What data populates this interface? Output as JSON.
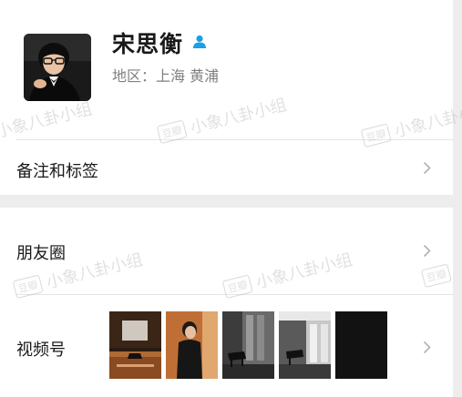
{
  "profile": {
    "name": "宋思衡",
    "region": "地区：上海 黄浦",
    "avatar_icon": "portrait-avatar",
    "badge_icon": "person-icon",
    "badge_color": "#1aa0e8"
  },
  "rows": {
    "remarks_label": "备注和标签",
    "moments_label": "朋友圈",
    "channels_label": "视频号"
  },
  "watermark": {
    "text": "小象八卦小组",
    "logo": "豆瓣"
  },
  "colors": {
    "background": "#ededed",
    "card": "#ffffff",
    "text": "#191919",
    "secondary_text": "#808080",
    "chevron": "#b2b2b2"
  }
}
